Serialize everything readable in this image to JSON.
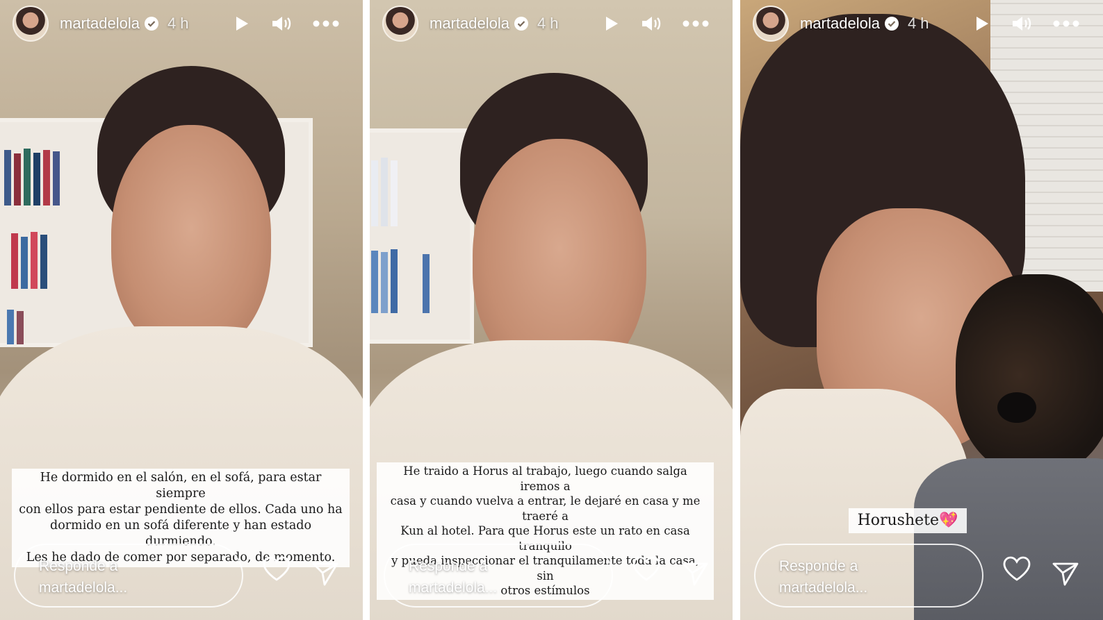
{
  "stories": [
    {
      "username": "martadelola",
      "time": "4 h",
      "caption": [
        "He dormido en el salón, en el sofá, para estar siempre",
        "con ellos para estar pendiente de ellos. Cada uno ha",
        "dormido en un sofá diferente y han estado durmiendo.",
        "Les he dado de comer por separado, de momento."
      ],
      "reply_placeholder": [
        "Responde a",
        "martadelola..."
      ]
    },
    {
      "username": "martadelola",
      "time": "4 h",
      "caption": [
        "He traido a Horus al trabajo, luego cuando salga iremos a",
        "casa y cuando vuelva a entrar, le dejaré en casa y me traeré a",
        "Kun al hotel. Para que Horus este un rato en casa tranquilo",
        "y pueda inspeccionar el tranquilamente toda la casa, sin",
        "otros estímulos"
      ],
      "reply_placeholder": [
        "Responde a",
        "martadelola..."
      ]
    },
    {
      "username": "martadelola",
      "time": "4 h",
      "caption": [
        "Horushete💖"
      ],
      "reply_placeholder": [
        "Responde a",
        "martadelola..."
      ]
    }
  ],
  "icons": {
    "play": "play-icon",
    "volume": "volume-icon",
    "more": "more-icon",
    "heart": "heart-icon",
    "send": "send-icon",
    "verified": "verified-badge-icon"
  },
  "colors": {
    "text": "#ffffff",
    "caption_bg": "#ffffff",
    "caption_text": "#1a1a1a"
  }
}
